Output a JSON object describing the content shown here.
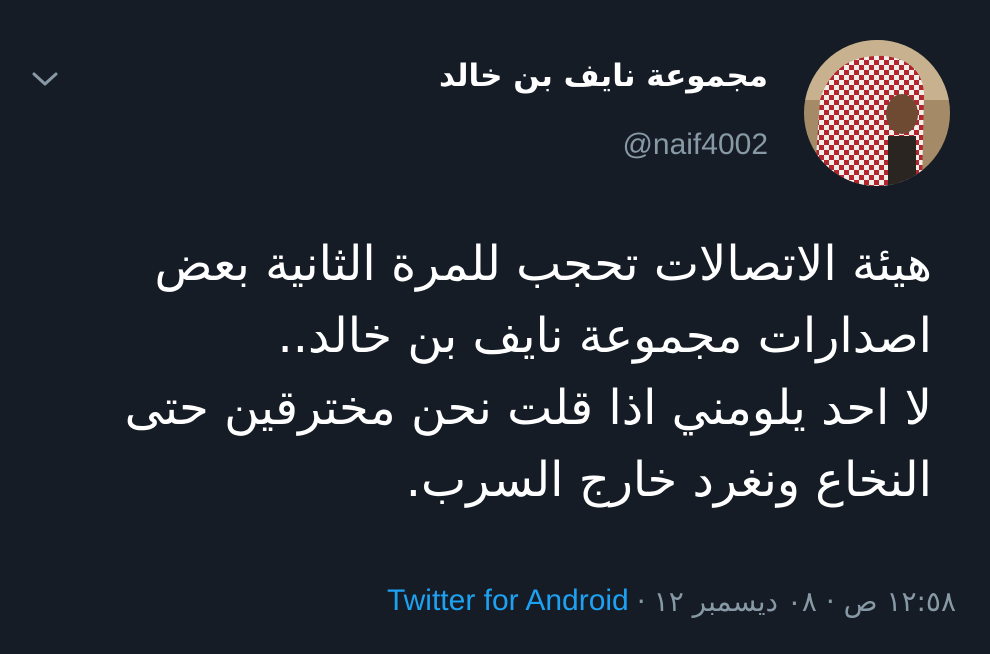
{
  "tweet": {
    "display_name": "مجموعة نايف بن خالد",
    "handle": "@naif4002",
    "text_lines": [
      "هيئة الاتصالات تحجب للمرة الثانية بعض",
      "اصدارات مجموعة نايف بن خالد..",
      "لا احد يلومني اذا قلت نحن مخترقين حتى",
      "النخاع ونغرد خارج السرب."
    ],
    "timestamp": "١٢:٥٨ ص · ٠٨ ديسمبر ١٢",
    "separator": "·",
    "source": "Twitter for Android"
  },
  "icons": {
    "more": "chevron-down-icon",
    "avatar": "avatar-image"
  },
  "colors": {
    "background": "#151c26",
    "text": "#ffffff",
    "secondary": "#8899a6",
    "link": "#1da1f2"
  }
}
